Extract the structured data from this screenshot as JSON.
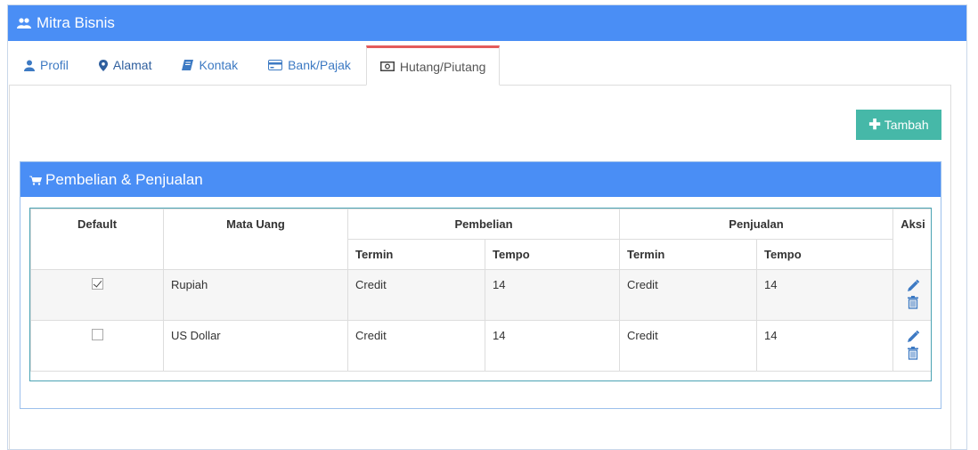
{
  "header": {
    "title": "Mitra Bisnis",
    "icon": "users-icon"
  },
  "tabs": [
    {
      "label": "Profil",
      "icon": "user-icon",
      "active": false
    },
    {
      "label": "Alamat",
      "icon": "map-marker-icon",
      "active": false
    },
    {
      "label": "Kontak",
      "icon": "book-icon",
      "active": false
    },
    {
      "label": "Bank/Pajak",
      "icon": "credit-card-icon",
      "active": false
    },
    {
      "label": "Hutang/Piutang",
      "icon": "money-icon",
      "active": true
    }
  ],
  "toolbar": {
    "add_label": "Tambah"
  },
  "panel": {
    "title": "Pembelian & Penjualan",
    "icon": "cart-icon"
  },
  "table": {
    "headers": {
      "default": "Default",
      "mata_uang": "Mata Uang",
      "pembelian": "Pembelian",
      "penjualan": "Penjualan",
      "aksi": "Aksi",
      "termin": "Termin",
      "tempo": "Tempo"
    },
    "rows": [
      {
        "default": true,
        "mata_uang": "Rupiah",
        "beli_termin": "Credit",
        "beli_tempo": "14",
        "jual_termin": "Credit",
        "jual_tempo": "14"
      },
      {
        "default": false,
        "mata_uang": "US Dollar",
        "beli_termin": "Credit",
        "beli_tempo": "14",
        "jual_termin": "Credit",
        "jual_tempo": "14"
      }
    ]
  },
  "colors": {
    "primary": "#4a8ef5",
    "accent": "#46b8a8",
    "tab_active_border": "#e45b5b",
    "link": "#3d7ac3"
  }
}
